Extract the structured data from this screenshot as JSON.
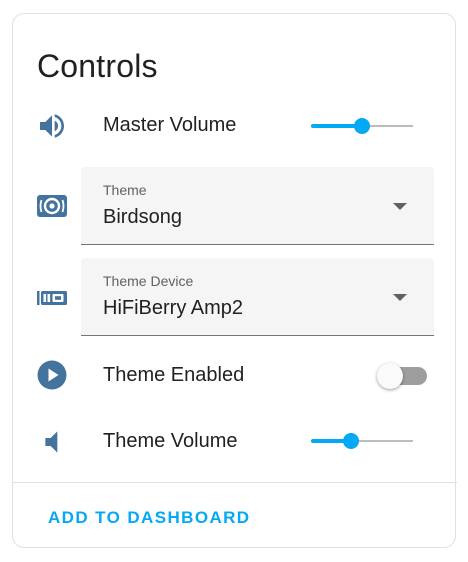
{
  "card": {
    "title": "Controls"
  },
  "controls": {
    "master_volume": {
      "label": "Master Volume",
      "value": 0.5,
      "icon": "volume-high-icon"
    },
    "theme": {
      "label": "Theme",
      "value": "Birdsong",
      "icon": "speaker-icon"
    },
    "theme_device": {
      "label": "Theme Device",
      "value": "HiFiBerry Amp2",
      "icon": "expansion-card-icon"
    },
    "theme_enabled": {
      "label": "Theme Enabled",
      "on": false,
      "icon": "play-circle-icon"
    },
    "theme_volume": {
      "label": "Theme Volume",
      "value": 0.39,
      "icon": "volume-low-icon"
    }
  },
  "actions": {
    "add_to_dashboard": "ADD TO DASHBOARD"
  },
  "colors": {
    "accent": "#03a9f4",
    "icon": "#44739e",
    "text": "#212121"
  }
}
